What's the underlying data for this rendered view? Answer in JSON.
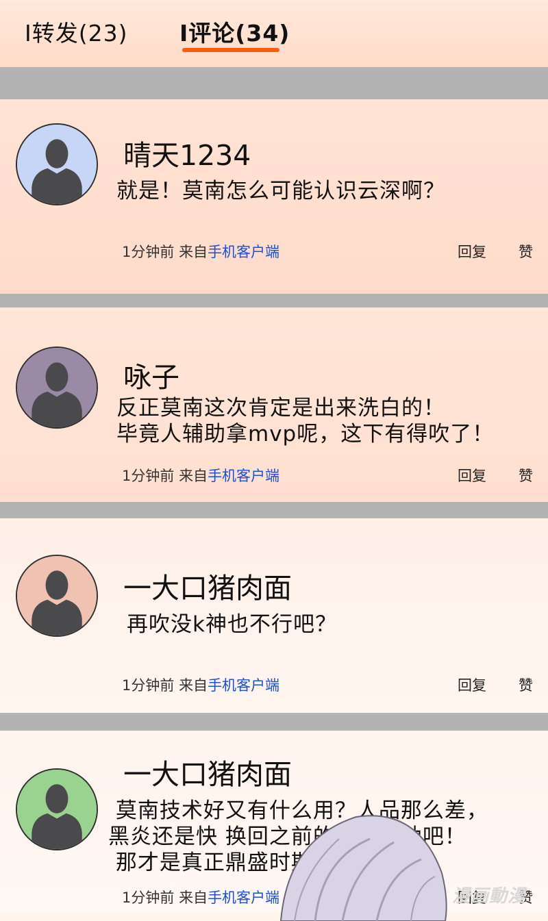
{
  "tabs": {
    "repost": "I转发(23)",
    "comments": "I评论(34)"
  },
  "comments": [
    {
      "name": "晴天1234",
      "text": "就是！莫南怎么可能认识云深啊？",
      "time": "1分钟前",
      "from_prefix": "来自",
      "source": "手机客户端",
      "reply": "回复",
      "like": "赞",
      "avatar_color": "#c7d6f7"
    },
    {
      "name": "咏子",
      "text": "反正莫南这次肯定是出来洗白的！\n毕竟人辅助拿mvp呢，这下有得吹了！",
      "time": "1分钟前",
      "from_prefix": "来自",
      "source": "手机客户端",
      "reply": "回复",
      "like": "赞",
      "avatar_color": "#9a8aa6"
    },
    {
      "name": "一大口猪肉面",
      "text": "再吹没k神也不行吧？",
      "time": "1分钟前",
      "from_prefix": "来自",
      "source": "手机客户端",
      "reply": "回复",
      "like": "赞",
      "avatar_color": "#f0c2b2"
    },
    {
      "name": "一大口猪肉面",
      "text": " 莫南技术好又有什么用？人品那么差，\n黑炎还是快 换回之前的那个辅助吧！\n 那才是真正鼎盛时期！",
      "time": "1分钟前",
      "from_prefix": "来自",
      "source": "手机客户端",
      "reply": "回复",
      "like": "赞",
      "avatar_color": "#9ad390"
    }
  ],
  "watermark": "漫画動漫",
  "colors": {
    "accent": "#ff5a14",
    "link": "#1a4fd8",
    "separator": "#b3b3b3"
  }
}
